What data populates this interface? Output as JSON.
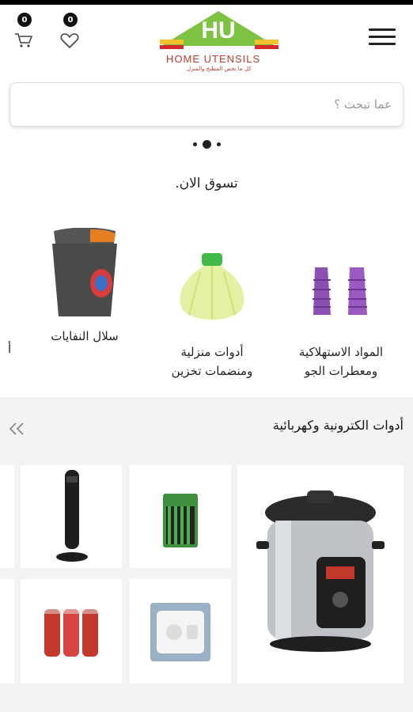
{
  "header": {
    "cart_count": "0",
    "wishlist_count": "0",
    "logo_text": "HOME UTENSILS",
    "logo_tagline": "كل ما يخص المطبخ والمنزل"
  },
  "search": {
    "placeholder": "عما تبحث ؟"
  },
  "carousel": {
    "slides": 3,
    "active": 2
  },
  "shop_now": {
    "title": "تسوق الان."
  },
  "categories": [
    {
      "label": "المواد الاستهلاكية ومعطرات الجو",
      "line1": "المواد الاستهلاكية",
      "line2": "ومعطرات الجو"
    },
    {
      "label": "أدوات منزلية ومنضمات تخزين",
      "line1": "أدوات منزلية",
      "line2": "ومنضمات تخزين"
    },
    {
      "label": "سلال النفايات",
      "line1": "سلال النفايات",
      "line2": ""
    },
    {
      "label": "أ",
      "line1": "أ",
      "line2": ""
    }
  ],
  "electronics_section": {
    "title": "أدوات الكترونية وكهربائية",
    "products": [
      {
        "name": "pressure-cooker"
      },
      {
        "name": "battery-pack-green"
      },
      {
        "name": "tower-fan"
      },
      {
        "name": "power-adapter"
      },
      {
        "name": "battery-pack-red"
      }
    ]
  },
  "colors": {
    "brand_green": "#7dc243",
    "brand_red": "#d62828",
    "brand_yellow": "#f2c12e"
  }
}
